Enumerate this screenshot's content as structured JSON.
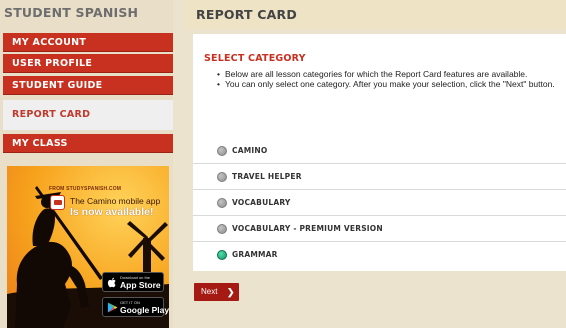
{
  "sidebar": {
    "brand": "STUDENT SPANISH",
    "items": [
      {
        "label": "MY ACCOUNT"
      },
      {
        "label": "USER PROFILE"
      },
      {
        "label": "STUDENT GUIDE"
      },
      {
        "label": "REPORT CARD",
        "active": true
      },
      {
        "label": "MY CLASS"
      }
    ]
  },
  "ad": {
    "source": "FROM STUDYSPANISH.COM",
    "line1": "The Camino mobile app",
    "line2": "Is now available!",
    "app_store": {
      "small": "Download on the",
      "big": "App Store"
    },
    "google_play": {
      "small": "GET IT ON",
      "big": "Google Play"
    }
  },
  "main": {
    "title": "REPORT CARD",
    "section_title": "SELECT CATEGORY",
    "instructions": [
      "Below are all lesson categories for which the Report Card features are available.",
      "You can only select one category. After you make your selection, click the \"Next\" button."
    ],
    "options": [
      {
        "label": "CAMINO",
        "selected": false
      },
      {
        "label": "TRAVEL HELPER",
        "selected": false
      },
      {
        "label": "VOCABULARY",
        "selected": false
      },
      {
        "label": "VOCABULARY - PREMIUM VERSION",
        "selected": false
      },
      {
        "label": "GRAMMAR",
        "selected": true
      }
    ],
    "next_label": "Next",
    "next_icon": "chevron-right-icon"
  },
  "colors": {
    "accent_red": "#c8301f",
    "next_red": "#a51a12",
    "selected_green": "#13936a",
    "background": "#ece3cf"
  }
}
